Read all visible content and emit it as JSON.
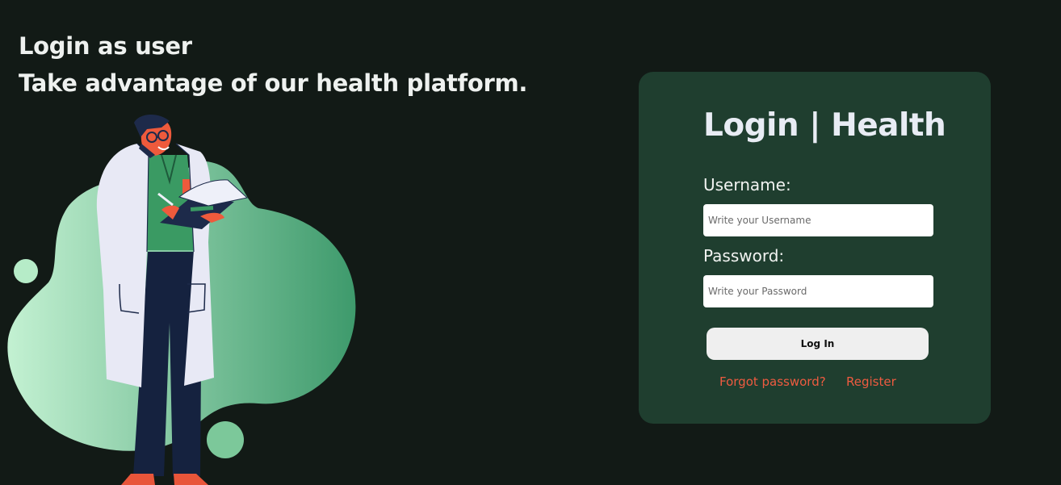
{
  "hero": {
    "line1": "Login as user",
    "line2": "Take advantage of our health platform."
  },
  "illustration": {
    "subject": "doctor-with-clipboard",
    "colors": {
      "blob_light": "#c3f1d2",
      "blob_dark": "#3e9a6c",
      "coat": "#e8e9f5",
      "scrubs": "#3a9a63",
      "pants": "#15223f",
      "skin": "#ee5a3c"
    }
  },
  "login_card": {
    "title": "Login | Health",
    "username_label": "Username:",
    "username_placeholder": "Write your Username",
    "password_label": "Password:",
    "password_placeholder": "Write your Password",
    "login_button": "Log In",
    "forgot_link": "Forgot password?",
    "register_link": "Register"
  },
  "colors": {
    "background": "#121a16",
    "card": "#1f3e2f",
    "accent": "#ee5b40"
  }
}
